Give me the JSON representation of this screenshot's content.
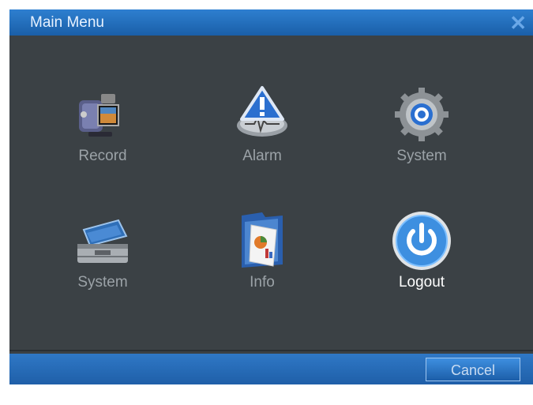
{
  "window": {
    "title": "Main Menu"
  },
  "menu": {
    "items": [
      {
        "label": "Record",
        "icon": "camcorder-icon"
      },
      {
        "label": "Alarm",
        "icon": "alarm-warning-icon"
      },
      {
        "label": "System",
        "icon": "gear-icon"
      },
      {
        "label": "System",
        "icon": "toolbox-icon"
      },
      {
        "label": "Info",
        "icon": "folder-info-icon"
      },
      {
        "label": "Logout",
        "icon": "power-icon"
      }
    ]
  },
  "footer": {
    "cancel_label": "Cancel"
  },
  "colors": {
    "titlebar": "#1a5fa8",
    "panel": "#3b4145",
    "label": "#9ba2a7"
  }
}
